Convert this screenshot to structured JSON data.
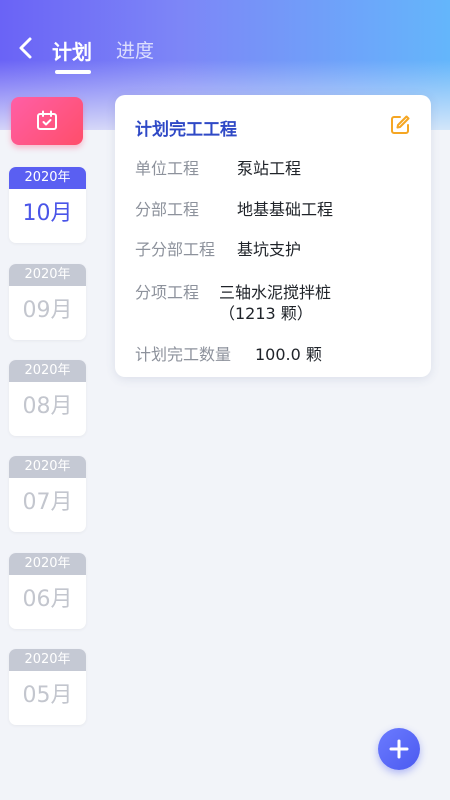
{
  "header": {
    "tabs": [
      {
        "label": "计划",
        "active": true
      },
      {
        "label": "进度",
        "active": false
      }
    ]
  },
  "sidebar": {
    "months": [
      {
        "year": "2020年",
        "month": "10月",
        "active": true
      },
      {
        "year": "2020年",
        "month": "09月",
        "active": false
      },
      {
        "year": "2020年",
        "month": "08月",
        "active": false
      },
      {
        "year": "2020年",
        "month": "07月",
        "active": false
      },
      {
        "year": "2020年",
        "month": "06月",
        "active": false
      },
      {
        "year": "2020年",
        "month": "05月",
        "active": false
      }
    ]
  },
  "plan": {
    "title": "计划完工工程",
    "rows": [
      {
        "label": "单位工程",
        "value": "泵站工程"
      },
      {
        "label": "分部工程",
        "value": "地基基础工程"
      },
      {
        "label": "子分部工程",
        "value": "基坑支护"
      },
      {
        "label": "分项工程",
        "value": "三轴水泥搅拌桩",
        "value2": "（1213 颗）"
      },
      {
        "label": "计划完工数量",
        "value": "100.0 颗"
      }
    ]
  },
  "colors": {
    "accent": "#4a55e8",
    "calendar_button": "#ff5590",
    "edit_icon": "#f5a623"
  },
  "icons": {
    "back": "chevron-left-icon",
    "calendar": "calendar-check-icon",
    "edit": "edit-icon",
    "add": "plus-icon"
  }
}
